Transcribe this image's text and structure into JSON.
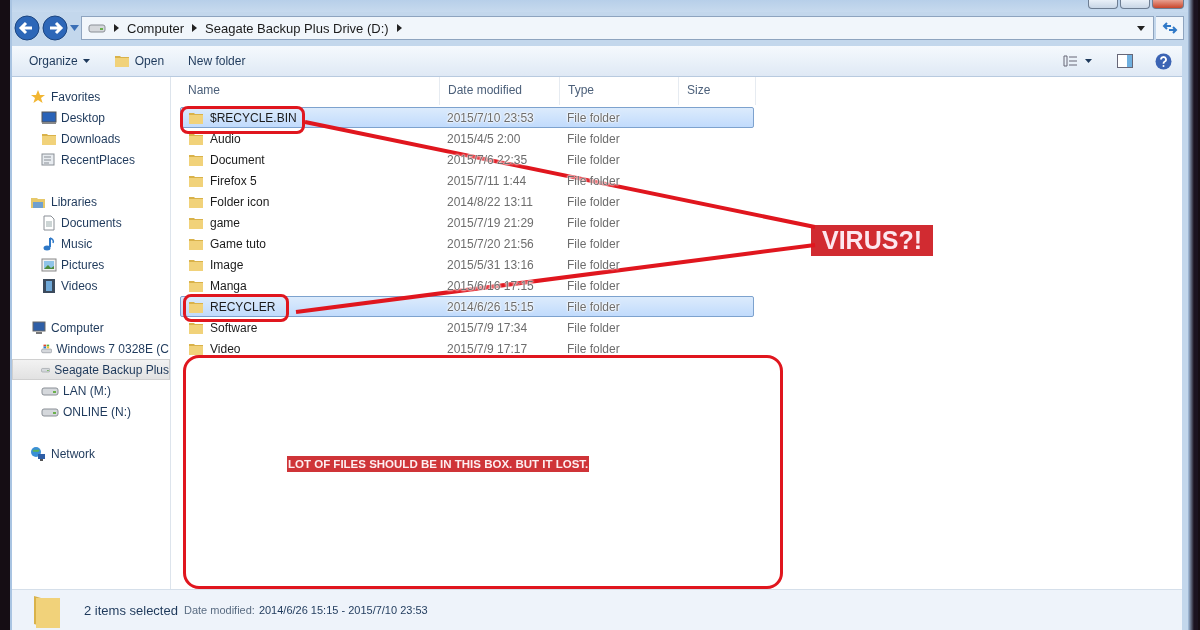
{
  "address_bar": {
    "crumbs": [
      "Computer",
      "Seagate Backup Plus Drive (D:)"
    ]
  },
  "toolbar": {
    "buttons": [
      {
        "label": "Organize",
        "kind": "menu"
      },
      {
        "label": "Open",
        "kind": "open"
      },
      {
        "label": "New folder",
        "kind": "plain"
      }
    ]
  },
  "sidebar": {
    "groups": [
      {
        "label": "Favorites",
        "kind": "star",
        "children": [
          {
            "label": "Desktop",
            "kind": "desktop",
            "selected": false
          },
          {
            "label": "Downloads",
            "kind": "folder",
            "selected": false
          },
          {
            "label": "RecentPlaces",
            "kind": "recent",
            "selected": false
          }
        ]
      },
      {
        "label": "Libraries",
        "kind": "library",
        "children": [
          {
            "label": "Documents",
            "kind": "document",
            "selected": false
          },
          {
            "label": "Music",
            "kind": "music",
            "selected": false
          },
          {
            "label": "Pictures",
            "kind": "pictures",
            "selected": false
          },
          {
            "label": "Videos",
            "kind": "videos",
            "selected": false
          }
        ]
      },
      {
        "label": "Computer",
        "kind": "computer",
        "children": [
          {
            "label": "Windows 7 0328E (C",
            "kind": "system-drive",
            "selected": false
          },
          {
            "label": "Seagate Backup Plus",
            "kind": "drive",
            "selected": true
          },
          {
            "label": "LAN (M:)",
            "kind": "drive",
            "selected": false
          },
          {
            "label": "ONLINE (N:)",
            "kind": "drive",
            "selected": false
          }
        ]
      },
      {
        "label": "Network",
        "kind": "network"
      }
    ]
  },
  "table": {
    "columns": [
      "Name",
      "Date modified",
      "Type",
      "Size"
    ],
    "rows": [
      {
        "name": "$RECYCLE.BIN",
        "date": "2015/7/10 23:53",
        "type": "File folder",
        "selected": true
      },
      {
        "name": "Audio",
        "date": "2015/4/5 2:00",
        "type": "File folder",
        "selected": false
      },
      {
        "name": "Document",
        "date": "2015/7/6 22:35",
        "type": "File folder",
        "selected": false
      },
      {
        "name": "Firefox 5",
        "date": "2015/7/11 1:44",
        "type": "File folder",
        "selected": false
      },
      {
        "name": "Folder icon",
        "date": "2014/8/22 13:11",
        "type": "File folder",
        "selected": false
      },
      {
        "name": "game",
        "date": "2015/7/19 21:29",
        "type": "File folder",
        "selected": false
      },
      {
        "name": "Game tuto",
        "date": "2015/7/20 21:56",
        "type": "File folder",
        "selected": false
      },
      {
        "name": "Image",
        "date": "2015/5/31 13:16",
        "type": "File folder",
        "selected": false
      },
      {
        "name": "Manga",
        "date": "2015/6/16 17:15",
        "type": "File folder",
        "selected": false
      },
      {
        "name": "RECYCLER",
        "date": "2014/6/26 15:15",
        "type": "File folder",
        "selected": true
      },
      {
        "name": "Software",
        "date": "2015/7/9 17:34",
        "type": "File folder",
        "selected": false
      },
      {
        "name": "Video",
        "date": "2015/7/9 17:17",
        "type": "File folder",
        "selected": false
      }
    ]
  },
  "status_bar": {
    "count": "2 items selected",
    "label": "Date modified:",
    "value": "2014/6/26 15:15 - 2015/7/10 23:53"
  },
  "annotations": {
    "callout": "VIRUS?!",
    "note": "LOT OF FILES SHOULD BE IN THIS BOX. BUT IT LOST."
  }
}
